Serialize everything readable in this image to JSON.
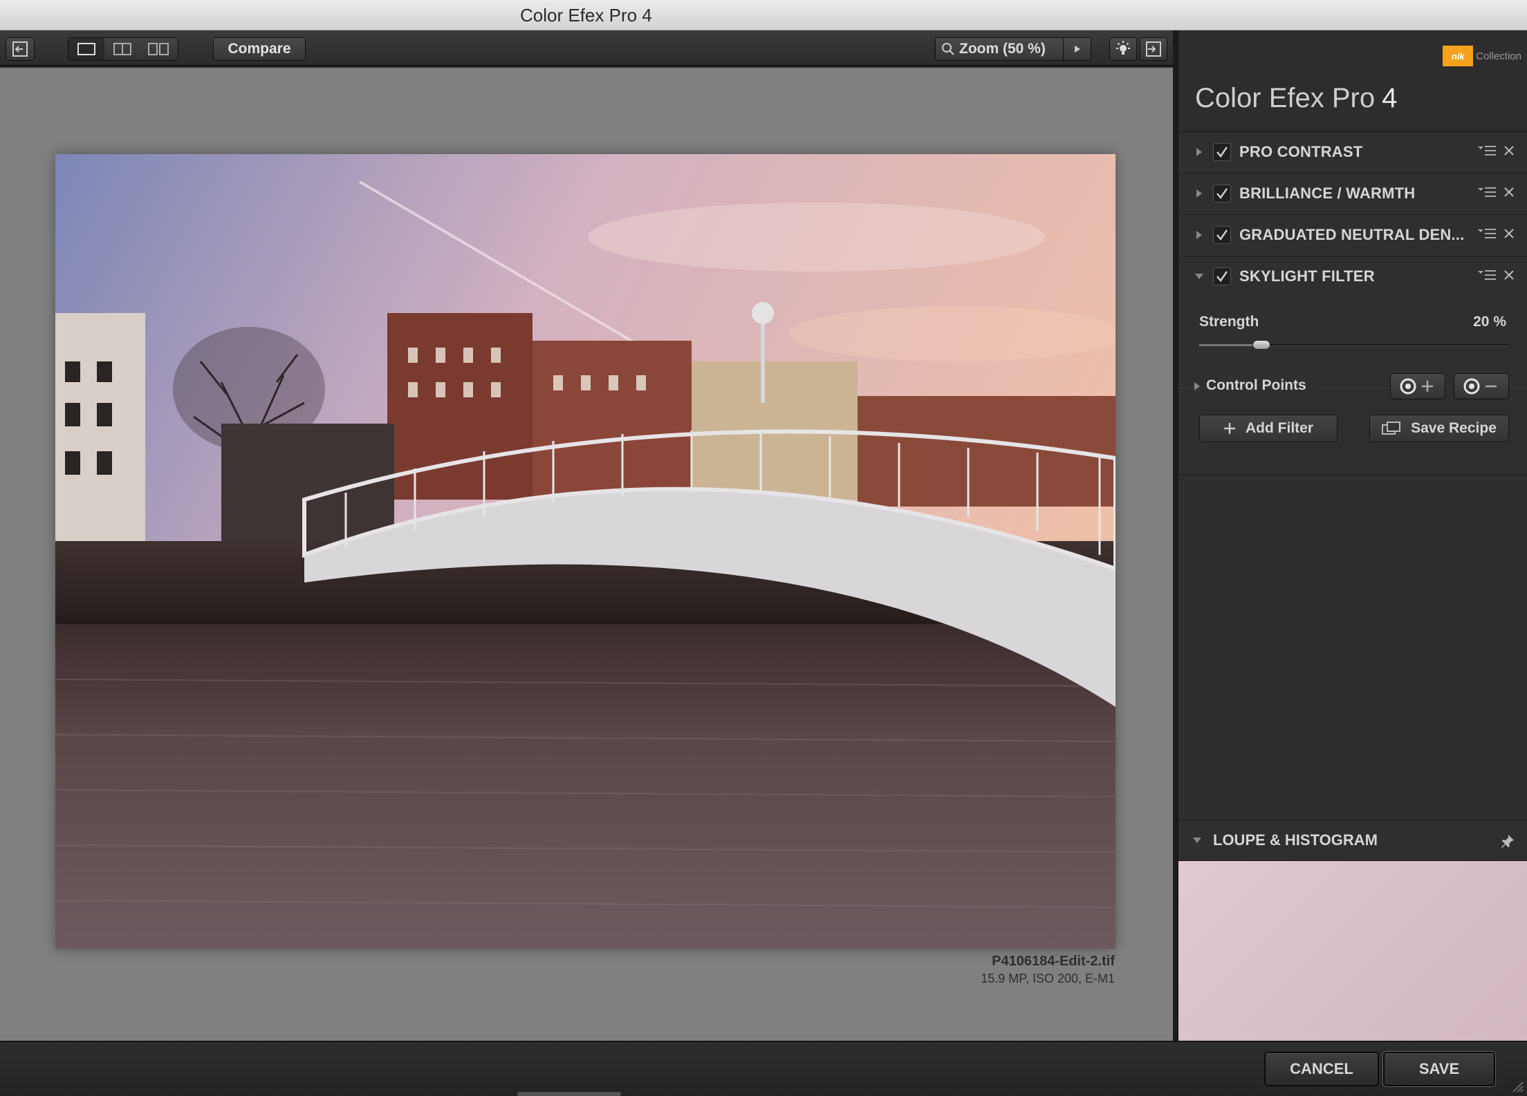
{
  "window": {
    "title": "Color Efex Pro 4"
  },
  "toolbar": {
    "compare_label": "Compare",
    "zoom_label": "Zoom (50 %)",
    "view_modes": [
      "single-view",
      "split-view",
      "side-by-side-view"
    ]
  },
  "image": {
    "file_name": "P4106184-Edit-2.tif",
    "meta": "15.9 MP, ISO 200, E-M1"
  },
  "panel": {
    "logo_badge": "nik",
    "logo_text": "Collection",
    "title": "Color Efex Pro",
    "title_version": "4",
    "filters": [
      {
        "label": "PRO CONTRAST",
        "enabled": true,
        "expanded": false
      },
      {
        "label": "BRILLIANCE / WARMTH",
        "enabled": true,
        "expanded": false
      },
      {
        "label": "GRADUATED NEUTRAL DEN...",
        "enabled": true,
        "expanded": false
      },
      {
        "label": "SKYLIGHT FILTER",
        "enabled": true,
        "expanded": true
      }
    ],
    "strength": {
      "label": "Strength",
      "value_text": "20 %",
      "value": 20
    },
    "control_points_label": "Control Points",
    "add_filter_label": "Add Filter",
    "save_recipe_label": "Save Recipe",
    "loupe_label": "LOUPE & HISTOGRAM"
  },
  "footer": {
    "cancel_label": "CANCEL",
    "save_label": "SAVE"
  },
  "colors": {
    "accent_logo": "#f2a21c",
    "canvas_bg": "#808080",
    "panel_bg": "#2d2d2d"
  }
}
